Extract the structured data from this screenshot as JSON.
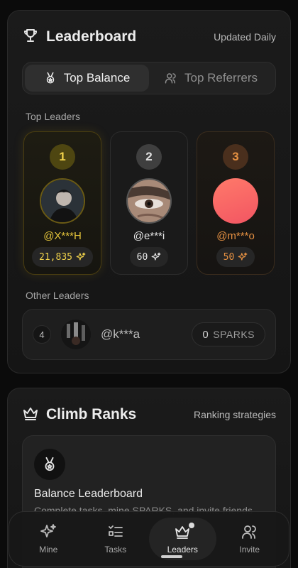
{
  "leaderboard": {
    "title": "Leaderboard",
    "updated": "Updated Daily",
    "tabs": [
      {
        "label": "Top Balance",
        "active": true
      },
      {
        "label": "Top Referrers",
        "active": false
      }
    ],
    "top_label": "Top Leaders",
    "top": [
      {
        "rank": "1",
        "name": "@X***H",
        "score": "21,835",
        "accent": "#e6c63b"
      },
      {
        "rank": "2",
        "name": "@e***i",
        "score": "60",
        "accent": "#e0e0e0"
      },
      {
        "rank": "3",
        "name": "@m***o",
        "score": "50",
        "accent": "#e69142"
      }
    ],
    "other_label": "Other Leaders",
    "others": [
      {
        "rank": "4",
        "name": "@k***a",
        "sparks_value": "0",
        "sparks_unit": "SPARKS"
      }
    ]
  },
  "climb": {
    "title": "Climb Ranks",
    "subtitle": "Ranking strategies",
    "strategy_title": "Balance Leaderboard",
    "strategy_desc": "Complete tasks, mine SPARKS, and invite friends"
  },
  "nav": [
    {
      "label": "Mine",
      "icon": "sparkle-icon",
      "active": false
    },
    {
      "label": "Tasks",
      "icon": "task-list-icon",
      "active": false
    },
    {
      "label": "Leaders",
      "icon": "crown-icon",
      "active": true
    },
    {
      "label": "Invite",
      "icon": "users-icon",
      "active": false
    }
  ]
}
